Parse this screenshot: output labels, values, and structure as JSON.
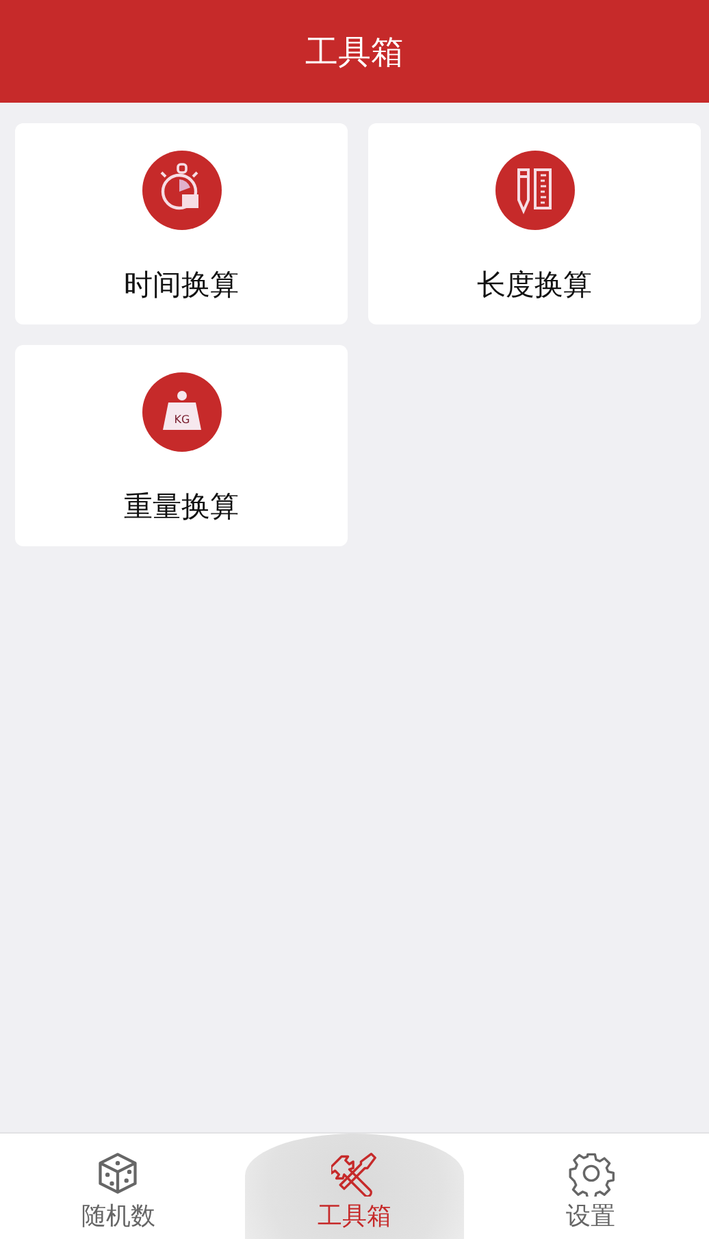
{
  "header": {
    "title": "工具箱"
  },
  "tools": [
    {
      "kind": "clock",
      "label": "时间换算"
    },
    {
      "kind": "ruler",
      "label": "长度换算"
    },
    {
      "kind": "weight",
      "label": "重量换算",
      "icon_text": "KG"
    }
  ],
  "tabs": [
    {
      "kind": "dice",
      "label": "随机数",
      "selected": false
    },
    {
      "kind": "tools",
      "label": "工具箱",
      "selected": true
    },
    {
      "kind": "gear",
      "label": "设置",
      "selected": false
    }
  ]
}
